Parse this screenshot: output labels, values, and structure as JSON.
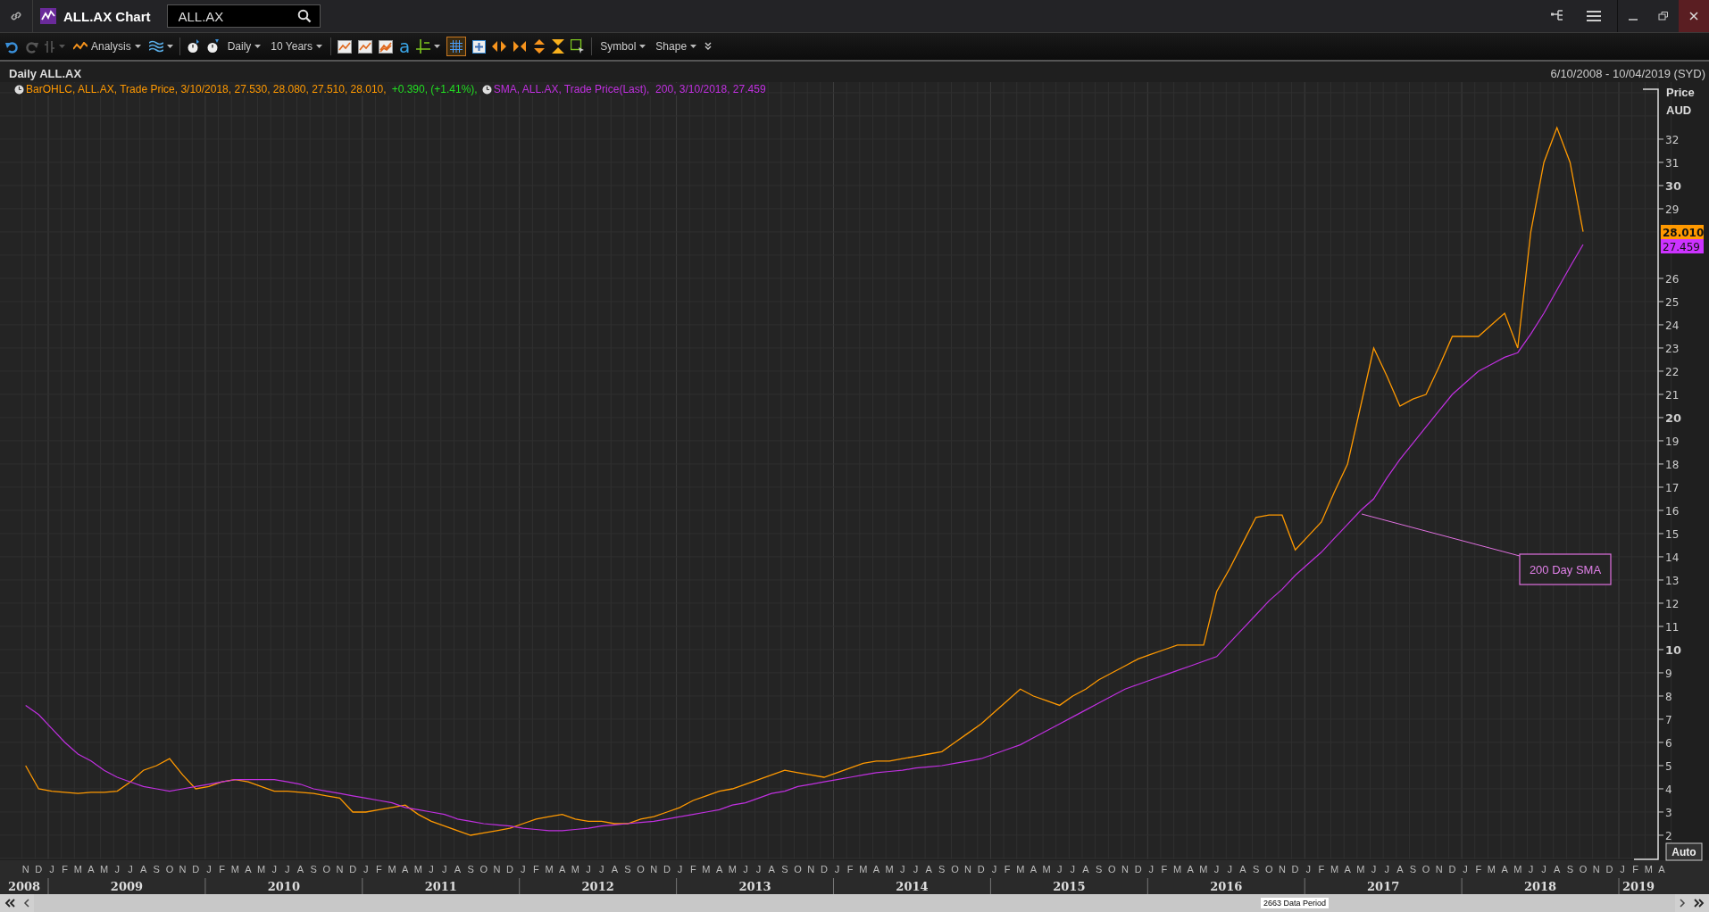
{
  "window": {
    "title": "ALL.AX Chart",
    "search": {
      "value": "ALL.AX"
    }
  },
  "toolbar": {
    "redo_disabled": true,
    "grid_selected": true,
    "text_tool": "a",
    "menus": [
      {
        "label": "Analysis"
      },
      {
        "label": "Daily"
      },
      {
        "label": "10 Years"
      },
      {
        "label": "Symbol"
      },
      {
        "label": "Shape"
      }
    ]
  },
  "chart_header": {
    "title": "Daily ALL.AX",
    "date_range": "6/10/2008 - 10/04/2019 (SYD)"
  },
  "legend": [
    {
      "text": ", 3/10/2018, 27.530, 28.080, 27.510, 28.010,",
      "change": "+0.390, (+1.41%),"
    },
    {
      "text": ", 3/10/2018, 27.459"
    }
  ],
  "chart": {
    "currency": "AUD",
    "auto_button": "Auto",
    "last_values": [
      {
        "text": "28.010",
        "color": "#ff9900"
      },
      {
        "text": "27.459",
        "color": "#cc33ff"
      }
    ],
    "chart_data": {
      "type": "line",
      "ylabel": "Price",
      "grid": true,
      "ylim": [
        0.96,
        34.46
      ],
      "yticks": [
        2,
        3,
        4,
        5,
        6,
        7,
        8,
        9,
        10,
        11,
        12,
        13,
        14,
        15,
        16,
        17,
        18,
        19,
        20,
        21,
        22,
        23,
        24,
        25,
        26,
        29,
        30,
        31,
        32
      ],
      "categories": [
        "N",
        "D",
        "J",
        "F",
        "M",
        "A",
        "M",
        "J",
        "J",
        "A",
        "S",
        "O",
        "N",
        "D",
        "J",
        "F",
        "M",
        "A",
        "M",
        "J",
        "J",
        "A",
        "S",
        "O",
        "N",
        "D",
        "J",
        "F",
        "M",
        "A",
        "M",
        "J",
        "J",
        "A",
        "S",
        "O",
        "N",
        "D",
        "J",
        "F",
        "M",
        "A",
        "M",
        "J",
        "J",
        "A",
        "S",
        "O",
        "N",
        "D",
        "J",
        "F",
        "M",
        "A",
        "M",
        "J",
        "J",
        "A",
        "S",
        "O",
        "N",
        "D",
        "J",
        "F",
        "M",
        "A",
        "M",
        "J",
        "J",
        "A",
        "S",
        "O",
        "N",
        "D",
        "J",
        "F",
        "M",
        "A",
        "M",
        "J",
        "J",
        "A",
        "S",
        "O",
        "N",
        "D",
        "J",
        "F",
        "M",
        "A",
        "M",
        "J",
        "J",
        "A",
        "S",
        "O",
        "N",
        "D",
        "J",
        "F",
        "M",
        "A",
        "M",
        "J",
        "J",
        "A",
        "S",
        "O",
        "N",
        "D",
        "J",
        "F",
        "M",
        "A",
        "M",
        "J",
        "J",
        "A",
        "S",
        "O",
        "N",
        "D",
        "J",
        "F",
        "M",
        "A"
      ],
      "series": [
        {
          "name": "BarOHLC, ALL.AX, Trade Price",
          "color": "#ff9900",
          "values": [
            5.0,
            4.0,
            3.9,
            3.85,
            3.8,
            3.85,
            3.85,
            3.9,
            4.3,
            4.8,
            5.0,
            5.3,
            4.6,
            4.0,
            4.1,
            4.3,
            4.4,
            4.3,
            4.1,
            3.9,
            3.9,
            3.85,
            3.8,
            3.7,
            3.6,
            3.0,
            3.0,
            3.1,
            3.2,
            3.3,
            2.9,
            2.6,
            2.4,
            2.2,
            2.0,
            2.1,
            2.2,
            2.3,
            2.5,
            2.7,
            2.8,
            2.9,
            2.7,
            2.6,
            2.6,
            2.5,
            2.5,
            2.7,
            2.8,
            3.0,
            3.2,
            3.5,
            3.7,
            3.9,
            4.0,
            4.2,
            4.4,
            4.6,
            4.8,
            4.7,
            4.6,
            4.5,
            4.7,
            4.9,
            5.1,
            5.2,
            5.2,
            5.3,
            5.4,
            5.5,
            5.6,
            6.0,
            6.4,
            6.8,
            7.3,
            7.8,
            8.3,
            8.0,
            7.8,
            7.6,
            8.0,
            8.3,
            8.7,
            9.0,
            9.3,
            9.6,
            9.8,
            10.0,
            10.2,
            10.2,
            10.2,
            12.5,
            13.5,
            14.6,
            15.7,
            15.8,
            15.8,
            14.3,
            14.9,
            15.5,
            16.8,
            18.0,
            20.5,
            23.0,
            21.8,
            20.5,
            20.8,
            21.0,
            22.2,
            23.5,
            23.5,
            23.5,
            24.0,
            24.5,
            23.0,
            28.0,
            31.0,
            32.5,
            31.0,
            28.01,
            null,
            null,
            null,
            null,
            null,
            null
          ]
        },
        {
          "name": "SMA, ALL.AX, Trade Price(Last),  200",
          "color": "#c030e0",
          "values": [
            7.6,
            7.2,
            6.6,
            6.0,
            5.5,
            5.2,
            4.8,
            4.5,
            4.3,
            4.1,
            4.0,
            3.9,
            4.0,
            4.1,
            4.2,
            4.3,
            4.4,
            4.4,
            4.4,
            4.4,
            4.3,
            4.2,
            4.0,
            3.9,
            3.8,
            3.7,
            3.6,
            3.5,
            3.4,
            3.2,
            3.1,
            3.0,
            2.9,
            2.7,
            2.6,
            2.5,
            2.45,
            2.4,
            2.3,
            2.25,
            2.2,
            2.2,
            2.25,
            2.3,
            2.4,
            2.45,
            2.5,
            2.55,
            2.6,
            2.7,
            2.8,
            2.9,
            3.0,
            3.1,
            3.3,
            3.4,
            3.6,
            3.8,
            3.9,
            4.1,
            4.2,
            4.3,
            4.4,
            4.5,
            4.6,
            4.7,
            4.75,
            4.8,
            4.9,
            4.95,
            5.0,
            5.1,
            5.2,
            5.3,
            5.5,
            5.7,
            5.9,
            6.2,
            6.5,
            6.8,
            7.1,
            7.4,
            7.7,
            8.0,
            8.3,
            8.5,
            8.7,
            8.9,
            9.1,
            9.3,
            9.5,
            9.7,
            10.3,
            10.9,
            11.5,
            12.1,
            12.6,
            13.2,
            13.7,
            14.2,
            14.8,
            15.4,
            16.0,
            16.5,
            17.4,
            18.2,
            18.9,
            19.6,
            20.3,
            21.0,
            21.5,
            22.0,
            22.3,
            22.6,
            22.8,
            23.6,
            24.5,
            25.5,
            26.5,
            27.46,
            null,
            null,
            null,
            null,
            null,
            null
          ]
        }
      ],
      "annotations": [
        {
          "text": "200 Day SMA"
        }
      ]
    },
    "time_axis": {
      "years": [
        "2008",
        "2009",
        "2010",
        "2011",
        "2012",
        "2013",
        "2014",
        "2015",
        "2016",
        "2017",
        "2018",
        "2019"
      ]
    }
  },
  "scrollbar": {
    "label": "2663 Data Period"
  }
}
